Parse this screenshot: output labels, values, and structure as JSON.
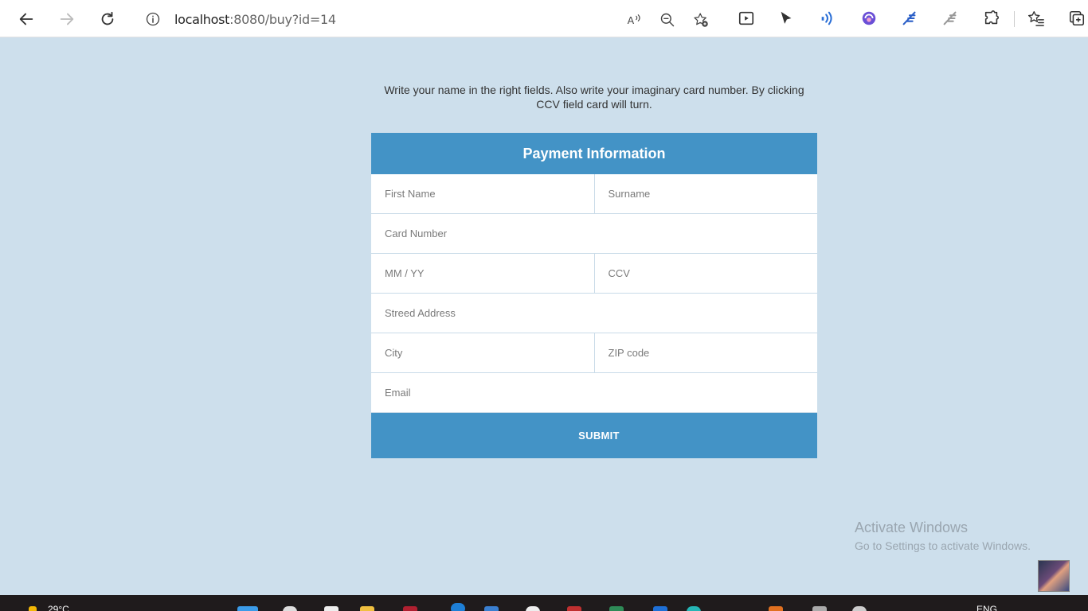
{
  "browser": {
    "url_host": "localhost",
    "url_rest": ":8080/buy?id=14"
  },
  "intro_text": "Write your name in the right fields. Also write your imaginary card number. By clicking CCV field card will turn.",
  "form": {
    "title": "Payment Information",
    "first_name_placeholder": "First Name",
    "surname_placeholder": "Surname",
    "card_number_placeholder": "Card Number",
    "expiry_placeholder": "MM / YY",
    "ccv_placeholder": "CCV",
    "address_placeholder": "Streed Address",
    "city_placeholder": "City",
    "zip_placeholder": "ZIP code",
    "email_placeholder": "Email",
    "submit_label": "SUBMIT"
  },
  "watermark": {
    "line1": "Activate Windows",
    "line2": "Go to Settings to activate Windows."
  },
  "taskbar": {
    "weather": "29°C",
    "language": "ENG"
  },
  "colors": {
    "page_background": "#cddfec",
    "accent": "#4393c6"
  }
}
